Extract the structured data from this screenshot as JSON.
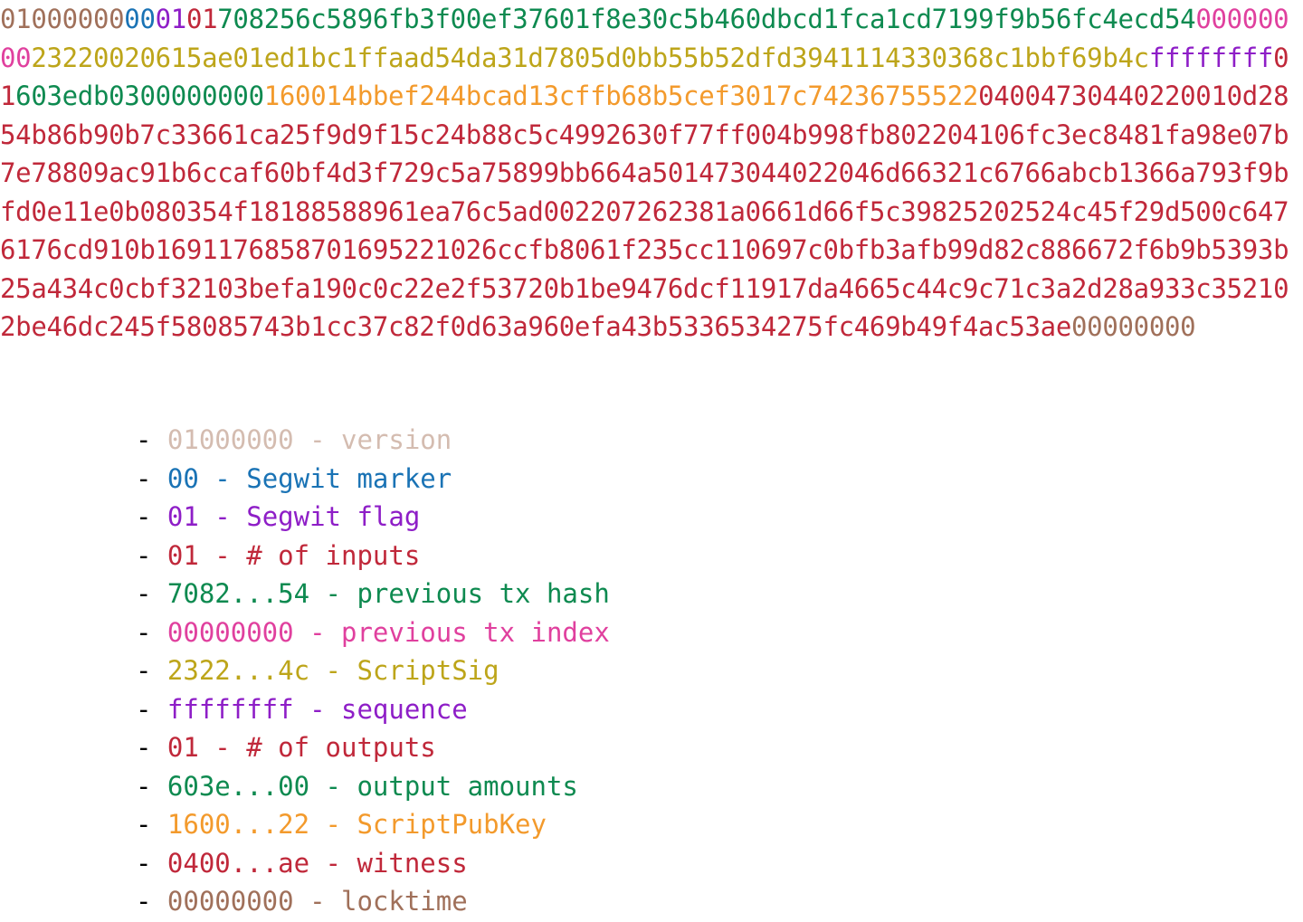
{
  "colors": {
    "version": "#a0705a",
    "segwit_marker": "#1a73b5",
    "segwit_flag": "#8e1ec7",
    "count": "#c0283a",
    "prev_hash": "#0e8a50",
    "prev_index": "#e0409e",
    "scriptsig": "#bda51a",
    "sequence": "#8e1ec7",
    "output_amounts": "#0e8a50",
    "scriptpubkey": "#f39a2c",
    "witness": "#c0283a",
    "locktime": "#a0705a",
    "legend_version": "#d4bcb0",
    "legend_dash": "#000000"
  },
  "hex_segments": [
    {
      "text": "01000000",
      "color_key": "version"
    },
    {
      "text": "00",
      "color_key": "segwit_marker"
    },
    {
      "text": "01",
      "color_key": "segwit_flag"
    },
    {
      "text": "01",
      "color_key": "count"
    },
    {
      "text": "708256c5896fb3f00ef37601f8e30c5b460dbcd1fca1cd7199f9b56fc4ecd54",
      "color_key": "prev_hash"
    },
    {
      "text": "00000000",
      "color_key": "prev_index"
    },
    {
      "text": "23220020615ae01ed1bc1ffaad54da31d7805d0bb55b52dfd3941114330368c1bbf69b4c",
      "color_key": "scriptsig"
    },
    {
      "text": "ffffffff",
      "color_key": "sequence"
    },
    {
      "text": "01",
      "color_key": "count"
    },
    {
      "text": "603edb0300000000",
      "color_key": "output_amounts"
    },
    {
      "text": "160014bbef244bcad13cffb68b5cef3017c742367555 22",
      "color_key": "scriptpubkey"
    },
    {
      "text": "0400473044022001 0d2854b86b90b7c33661ca25f9d9f15c24b88c5c4992630f77ff004b998fb802204106fc3ec8481fa98e07b7e78809ac91b6ccaf60bf4d3f729c5a75899bb664a501473044022046d66321c6766abcb1366a793f9bfd0e11e0b080354f18188588961ea76c5ad002207262381a0661d66f5c39825202524c45f29d500c6476176cd910b169117685870169522102 6ccfb8061f235cc110697c0bfb3afb99d82c886672f6b9b5393b25a434c0cbf32103befa190c0c22e2f53720b1be9476dcf11917da4665c44c9c71c3a2d28a933c352102be46dc245f58085743b1cc37c82f0d63a960efa43b5336534275fc469b49f4ac53ae",
      "color_key": "witness"
    },
    {
      "text": "00000000",
      "color_key": "locktime"
    }
  ],
  "legend": [
    {
      "dash": "- ",
      "code": "01000000",
      "sep": " - ",
      "label": "version",
      "color_key": "legend_version"
    },
    {
      "dash": "- ",
      "code": "00",
      "sep": " - ",
      "label": "Segwit marker",
      "color_key": "segwit_marker"
    },
    {
      "dash": "- ",
      "code": "01",
      "sep": " - ",
      "label": "Segwit flag",
      "color_key": "segwit_flag"
    },
    {
      "dash": "- ",
      "code": "01",
      "sep": " - ",
      "label": "# of inputs",
      "color_key": "count"
    },
    {
      "dash": "- ",
      "code": "7082...54",
      "sep": " - ",
      "label": "previous tx hash",
      "color_key": "prev_hash"
    },
    {
      "dash": "- ",
      "code": "00000000",
      "sep": " - ",
      "label": "previous tx index",
      "color_key": "prev_index"
    },
    {
      "dash": "- ",
      "code": "2322...4c",
      "sep": " - ",
      "label": "ScriptSig",
      "color_key": "scriptsig"
    },
    {
      "dash": "- ",
      "code": "ffffffff",
      "sep": " - ",
      "label": "sequence",
      "color_key": "sequence"
    },
    {
      "dash": "- ",
      "code": "01",
      "sep": " - ",
      "label": "# of outputs",
      "color_key": "count"
    },
    {
      "dash": "- ",
      "code": "603e...00",
      "sep": " - ",
      "label": "output amounts",
      "color_key": "output_amounts"
    },
    {
      "dash": "- ",
      "code": "1600...22",
      "sep": " - ",
      "label": "ScriptPubKey",
      "color_key": "scriptpubkey"
    },
    {
      "dash": "- ",
      "code": "0400...ae",
      "sep": " - ",
      "label": "witness",
      "color_key": "witness"
    },
    {
      "dash": "- ",
      "code": "00000000",
      "sep": " - ",
      "label": "locktime",
      "color_key": "locktime"
    }
  ]
}
